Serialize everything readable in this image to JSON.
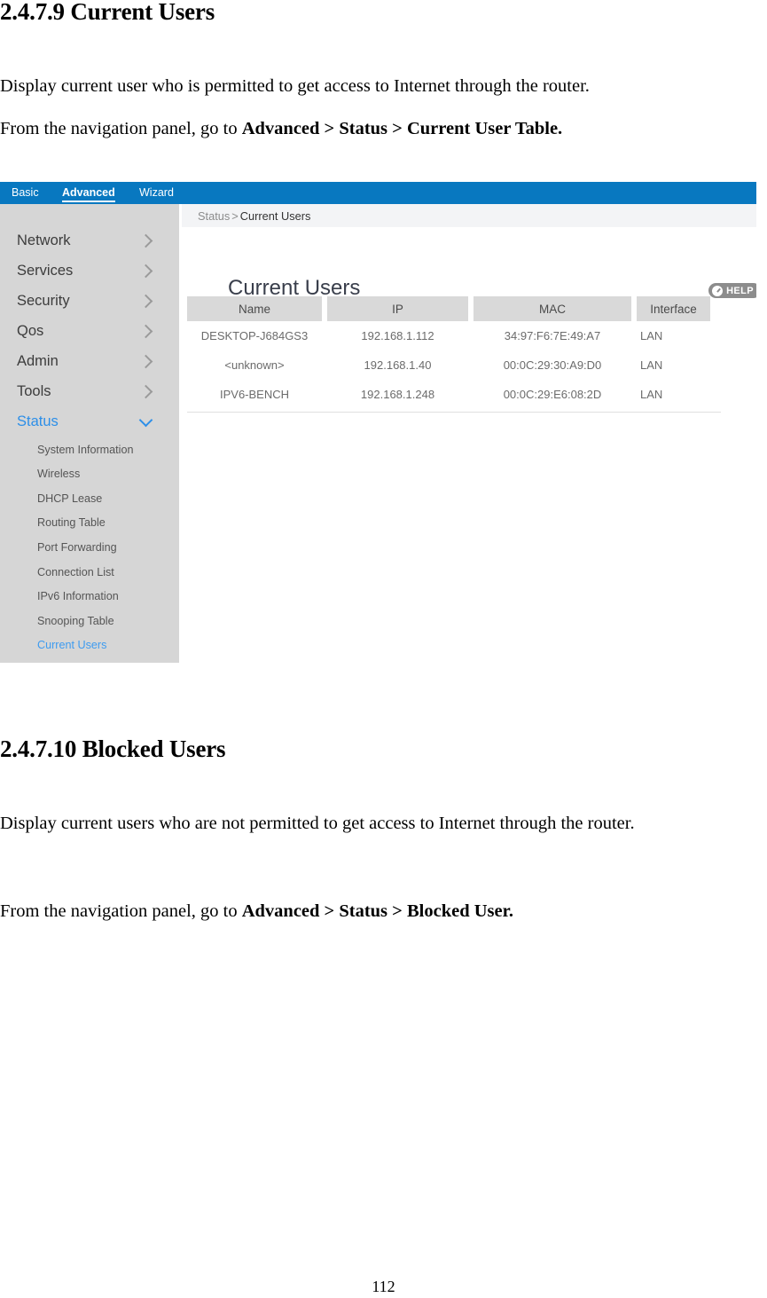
{
  "document": {
    "section_current": {
      "heading": "2.4.7.9 Current Users",
      "paragraph_1": "Display current user who is permitted to get access to Internet through the router.",
      "paragraph_2_prefix": "From the navigation panel, go to ",
      "paragraph_2_path": "Advanced > Status > Current User Table."
    },
    "section_blocked": {
      "heading": "2.4.7.10 Blocked Users",
      "paragraph_1": "Display current users who are not permitted to get access to Internet through the router.",
      "paragraph_2_prefix": "From the navigation panel, go to ",
      "paragraph_2_path": "Advanced > Status > Blocked User."
    },
    "page_number": "112"
  },
  "router_ui": {
    "top_nav": {
      "items": [
        {
          "label": "Basic",
          "active": false
        },
        {
          "label": "Advanced",
          "active": true
        },
        {
          "label": "Wizard",
          "active": false
        }
      ]
    },
    "sidebar": {
      "groups": [
        {
          "label": "Network",
          "expanded": false,
          "icon": "chevron-right-icon"
        },
        {
          "label": "Services",
          "expanded": false,
          "icon": "chevron-right-icon"
        },
        {
          "label": "Security",
          "expanded": false,
          "icon": "chevron-right-icon"
        },
        {
          "label": "Qos",
          "expanded": false,
          "icon": "chevron-right-icon"
        },
        {
          "label": "Admin",
          "expanded": false,
          "icon": "chevron-right-icon"
        },
        {
          "label": "Tools",
          "expanded": false,
          "icon": "chevron-right-icon"
        },
        {
          "label": "Status",
          "expanded": true,
          "icon": "chevron-down-icon"
        }
      ],
      "sub_items": [
        {
          "label": "System Information",
          "active": false
        },
        {
          "label": "Wireless",
          "active": false
        },
        {
          "label": "DHCP Lease",
          "active": false
        },
        {
          "label": "Routing Table",
          "active": false
        },
        {
          "label": "Port Forwarding",
          "active": false
        },
        {
          "label": "Connection List",
          "active": false
        },
        {
          "label": "IPv6 Information",
          "active": false
        },
        {
          "label": "Snooping Table",
          "active": false
        },
        {
          "label": "Current Users",
          "active": true
        }
      ]
    },
    "breadcrumb": {
      "parent": "Status",
      "separator": ">",
      "current": "Current Users"
    },
    "panel_title": "Current Users",
    "help_button": {
      "label": "HELP",
      "icon": "help-question-icon"
    },
    "table": {
      "columns": [
        "Name",
        "IP",
        "MAC",
        "Interface"
      ],
      "rows": [
        {
          "name": "DESKTOP-J684GS3",
          "ip": "192.168.1.112",
          "mac": "34:97:F6:7E:49:A7",
          "interface": "LAN"
        },
        {
          "name": "<unknown>",
          "ip": "192.168.1.40",
          "mac": "00:0C:29:30:A9:D0",
          "interface": "LAN"
        },
        {
          "name": "IPV6-BENCH",
          "ip": "192.168.1.248",
          "mac": "00:0C:29:E6:08:2D",
          "interface": "LAN"
        }
      ]
    },
    "colors": {
      "nav_blue": "#0878c0",
      "sidebar_gray": "#d6d6d6",
      "breadcrumb_gray": "#f3f4f6",
      "table_header_gray": "#d9d9d9",
      "active_link_blue": "#3d9bf0",
      "help_gray": "#8c8c8c"
    }
  }
}
